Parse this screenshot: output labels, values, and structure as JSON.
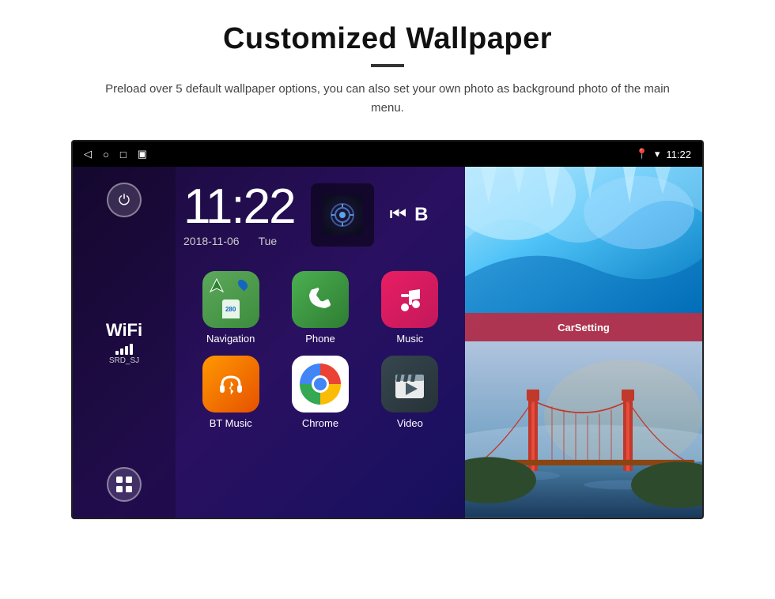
{
  "page": {
    "title": "Customized Wallpaper",
    "subtitle": "Preload over 5 default wallpaper options, you can also set your own photo as background photo of the main menu."
  },
  "device": {
    "status_bar": {
      "time": "11:22",
      "wifi_icon": "wifi",
      "location_icon": "location"
    },
    "clock": {
      "time": "11:22",
      "date": "2018-11-06",
      "day": "Tue"
    },
    "wifi": {
      "label": "WiFi",
      "ssid": "SRD_SJ"
    },
    "apps": [
      {
        "name": "Navigation",
        "icon": "navigation"
      },
      {
        "name": "Phone",
        "icon": "phone"
      },
      {
        "name": "Music",
        "icon": "music"
      },
      {
        "name": "BT Music",
        "icon": "bt-music"
      },
      {
        "name": "Chrome",
        "icon": "chrome"
      },
      {
        "name": "Video",
        "icon": "video"
      }
    ],
    "car_setting": "CarSetting"
  }
}
